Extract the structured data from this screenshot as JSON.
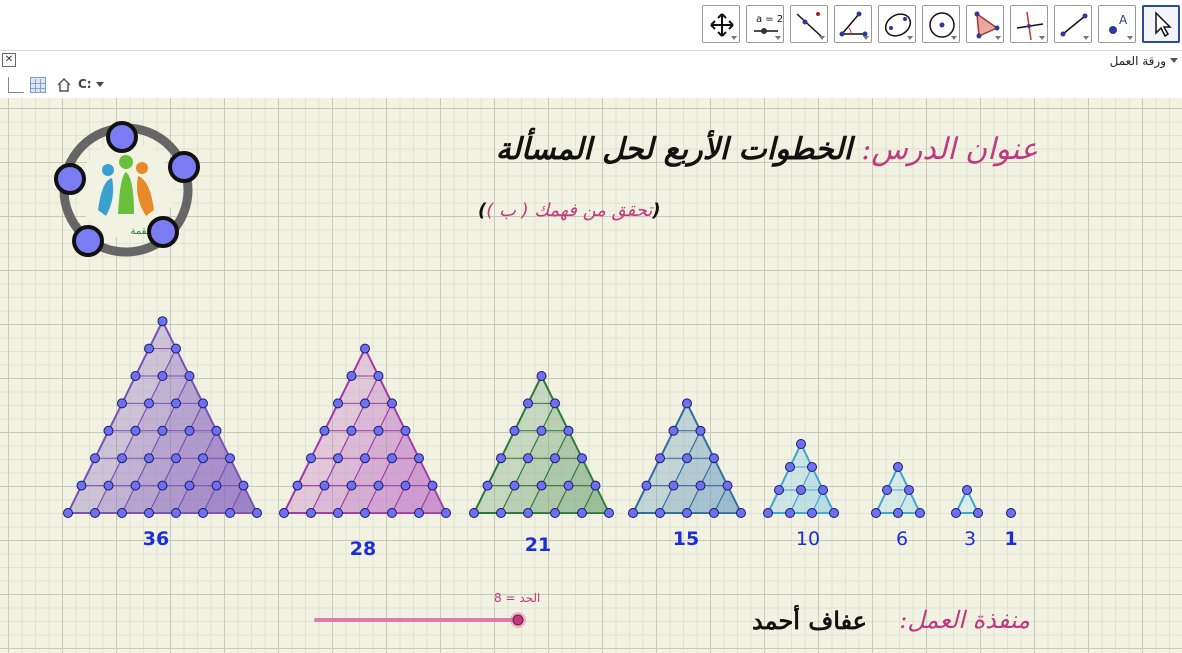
{
  "toolbar": {
    "tools": [
      {
        "name": "move-graphic-view",
        "icon": "move-arrows-icon"
      },
      {
        "name": "slider",
        "icon": "slider-icon",
        "label": "a = 2"
      },
      {
        "name": "line-through-two-points",
        "icon": "line-icon"
      },
      {
        "name": "angle",
        "icon": "angle-icon"
      },
      {
        "name": "conic-through-five-points",
        "icon": "conic-icon"
      },
      {
        "name": "circle-center-point",
        "icon": "circle-icon"
      },
      {
        "name": "polygon",
        "icon": "polygon-icon"
      },
      {
        "name": "perpendicular-line",
        "icon": "perpendicular-icon"
      },
      {
        "name": "segment",
        "icon": "segment-icon"
      },
      {
        "name": "new-point",
        "icon": "point-icon",
        "label": "A"
      },
      {
        "name": "move",
        "icon": "cursor-icon"
      }
    ]
  },
  "view": {
    "title": "ورقة العمل"
  },
  "stylebar": {
    "zoom_label": "C:"
  },
  "worksheet": {
    "title_label": "عنوان الدرس:",
    "title_text": "الخطوات الأربع لحل المسألة",
    "subtitle_open": "(",
    "subtitle_text": "تحقق من فهمك ( ب )",
    "subtitle_close": ")",
    "author_label": "منفذة العمل:",
    "author_name": "عفاف أحمد",
    "logo_text": "معاً للقمة"
  },
  "slider": {
    "label": "الحد = 8",
    "value": 8,
    "color": "#e07aa8"
  },
  "figures": [
    {
      "n": 8,
      "count_label": "36",
      "color": "#7a52b8",
      "fill": "#8a6cc0"
    },
    {
      "n": 7,
      "count_label": "28",
      "color": "#a23aa8",
      "fill": "#c07cc6"
    },
    {
      "n": 6,
      "count_label": "21",
      "color": "#2a7a3a",
      "fill": "#78aa7e"
    },
    {
      "n": 5,
      "count_label": "15",
      "color": "#2e6fa0",
      "fill": "#6e9ec0"
    },
    {
      "n": 4,
      "count_label": "10",
      "color": "#3da6d6",
      "fill": "#8ccfe8"
    },
    {
      "n": 3,
      "count_label": "6",
      "color": "#3da6d6",
      "fill": "#a6dcec"
    },
    {
      "n": 2,
      "count_label": "3",
      "color": "#3da6d6",
      "fill": "#b8e4f0"
    },
    {
      "n": 1,
      "count_label": "1",
      "color": "#3da6d6",
      "fill": "#b8e4f0"
    }
  ],
  "colors": {
    "accent": "#c0397f",
    "number_blue": "#1c2fd6",
    "point_fill": "#6f70ef",
    "point_stroke": "#1a1a6a",
    "grid_background": "#f2f2e3"
  }
}
